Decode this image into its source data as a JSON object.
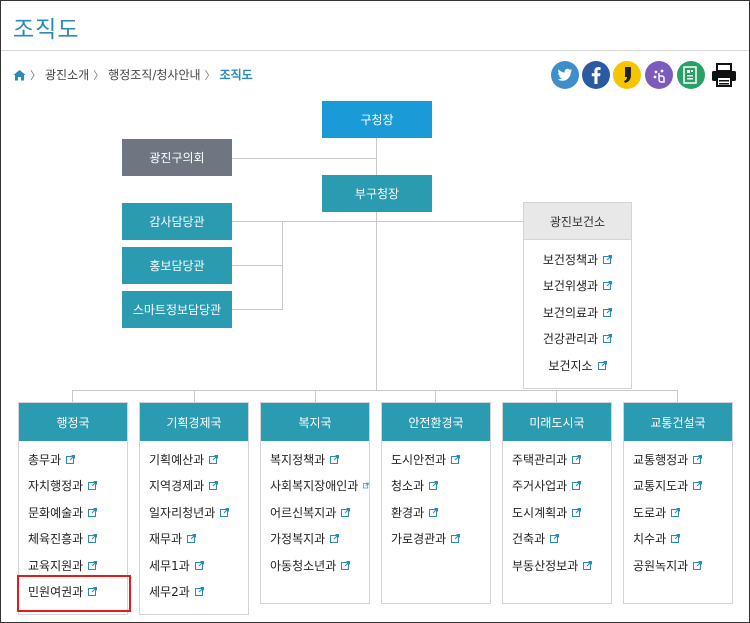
{
  "page": {
    "title": "조직도"
  },
  "breadcrumb": {
    "items": [
      "광진소개",
      "행정조직/청사안내"
    ],
    "current": "조직도"
  },
  "sns": [
    {
      "name": "twitter",
      "color": "#3e8fc9",
      "glyph": "t"
    },
    {
      "name": "facebook",
      "color": "#2c5aa0",
      "glyph": "f"
    },
    {
      "name": "kakaostory",
      "color": "#f7c400",
      "glyph": ","
    },
    {
      "name": "band",
      "color": "#7d5bbe",
      "glyph": "b"
    },
    {
      "name": "qr",
      "color": "#28a068",
      "glyph": "▦"
    }
  ],
  "org": {
    "head": "구청장",
    "council": "광진구의회",
    "deputy": "부구청장",
    "offices": [
      "감사담당관",
      "홍보담당관",
      "스마트정보담당관"
    ],
    "health_center": {
      "name": "광진보건소",
      "items": [
        "보건정책과",
        "보건위생과",
        "보건의료과",
        "건강관리과",
        "보건지소"
      ]
    },
    "bureaus": [
      {
        "name": "행정국",
        "items": [
          "총무과",
          "자치행정과",
          "문화예술과",
          "체육진흥과",
          "교육지원과",
          "민원여권과"
        ]
      },
      {
        "name": "기획경제국",
        "items": [
          "기획예산과",
          "지역경제과",
          "일자리청년과",
          "재무과",
          "세무1과",
          "세무2과"
        ]
      },
      {
        "name": "복지국",
        "items": [
          "복지정책과",
          "사회복지장애인과",
          "어르신복지과",
          "가정복지과",
          "아동청소년과"
        ]
      },
      {
        "name": "안전환경국",
        "items": [
          "도시안전과",
          "청소과",
          "환경과",
          "가로경관과"
        ]
      },
      {
        "name": "미래도시국",
        "items": [
          "주택관리과",
          "주거사업과",
          "도시계획과",
          "건축과",
          "부동산정보과"
        ]
      },
      {
        "name": "교통건설국",
        "items": [
          "교통행정과",
          "교통지도과",
          "도로과",
          "치수과",
          "공원녹지과"
        ]
      }
    ]
  }
}
